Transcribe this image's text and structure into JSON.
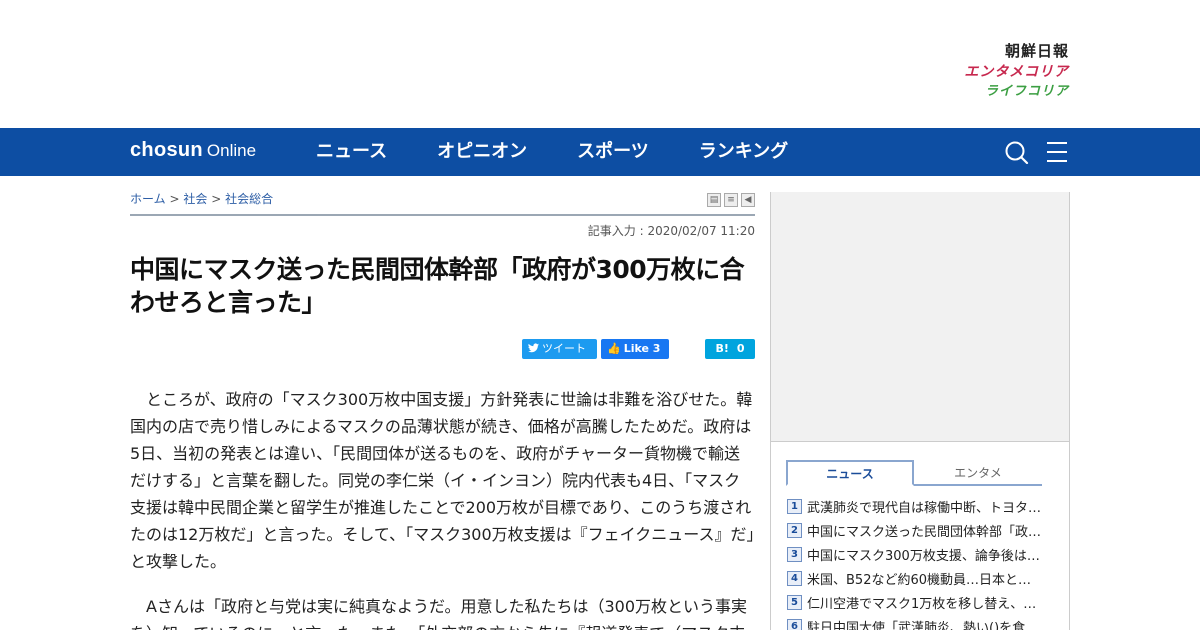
{
  "brands": [
    "朝鮮日報",
    "エンタメコリア",
    "ライフコリア"
  ],
  "nav": {
    "logo_main": "chosun",
    "logo_sub": "Online",
    "items": [
      "ニュース",
      "オピニオン",
      "スポーツ",
      "ランキング"
    ],
    "icons": [
      "search-icon",
      "menu-icon"
    ]
  },
  "breadcrumb": [
    "ホーム",
    ">",
    "社会",
    ">",
    "社会総合"
  ],
  "tools": [
    "print-icon",
    "text-icon",
    "back-icon"
  ],
  "date": "記事入力 : 2020/02/07 11:20",
  "headline": "中国にマスク送った民間団体幹部「政府が300万枚に合わせろと言った」",
  "share": {
    "tweet": "ツイート",
    "like": "Like 3",
    "hatena_icon": "B!",
    "hatena_count": "0"
  },
  "body": [
    "ところが、政府の「マスク300万枚中国支援」方針発表に世論は非難を浴びせた。韓国内の店で売り惜しみによるマスクの品薄状態が続き、価格が高騰したためだ。政府は5日、当初の発表とは違い、「民間団体が送るものを、政府がチャーター貨物機で輸送だけする」と言葉を翻した。同党の李仁栄（イ・インヨン）院内代表も4日、「マスク支援は韓中民間企業と留学生が推進したことで200万枚が目標であり、このうち渡されたのは12万枚だ」と言った。そして、「マスク300万枚支援は『フェイクニュース』だ」と攻撃した。",
    "Aさんは「政府と与党は実に純真なようだ。用意した私たちは（300万枚という事実を）知っているのに」と言った。また、「外交部の方から先に『報道発表で（マスク支"
  ],
  "sidebar": {
    "tabs": [
      "ニュース",
      "エンタメ"
    ],
    "ranking": [
      {
        "n": "1",
        "text": "武漢肺炎で現代自は稼働中断、トヨタは…"
      },
      {
        "n": "2",
        "text": "中国にマスク送った民間団体幹部「政府…"
      },
      {
        "n": "3",
        "text": "中国にマスク300万枚支援、論争後は…"
      },
      {
        "n": "4",
        "text": "米国、B52など約60機動員…日本と大…"
      },
      {
        "n": "5",
        "text": "仁川空港でマスク1万枚を移し替え、…"
      },
      {
        "n": "6",
        "text": "駐日中国大使「武漢肺炎、熱い()を食い…"
      }
    ]
  }
}
